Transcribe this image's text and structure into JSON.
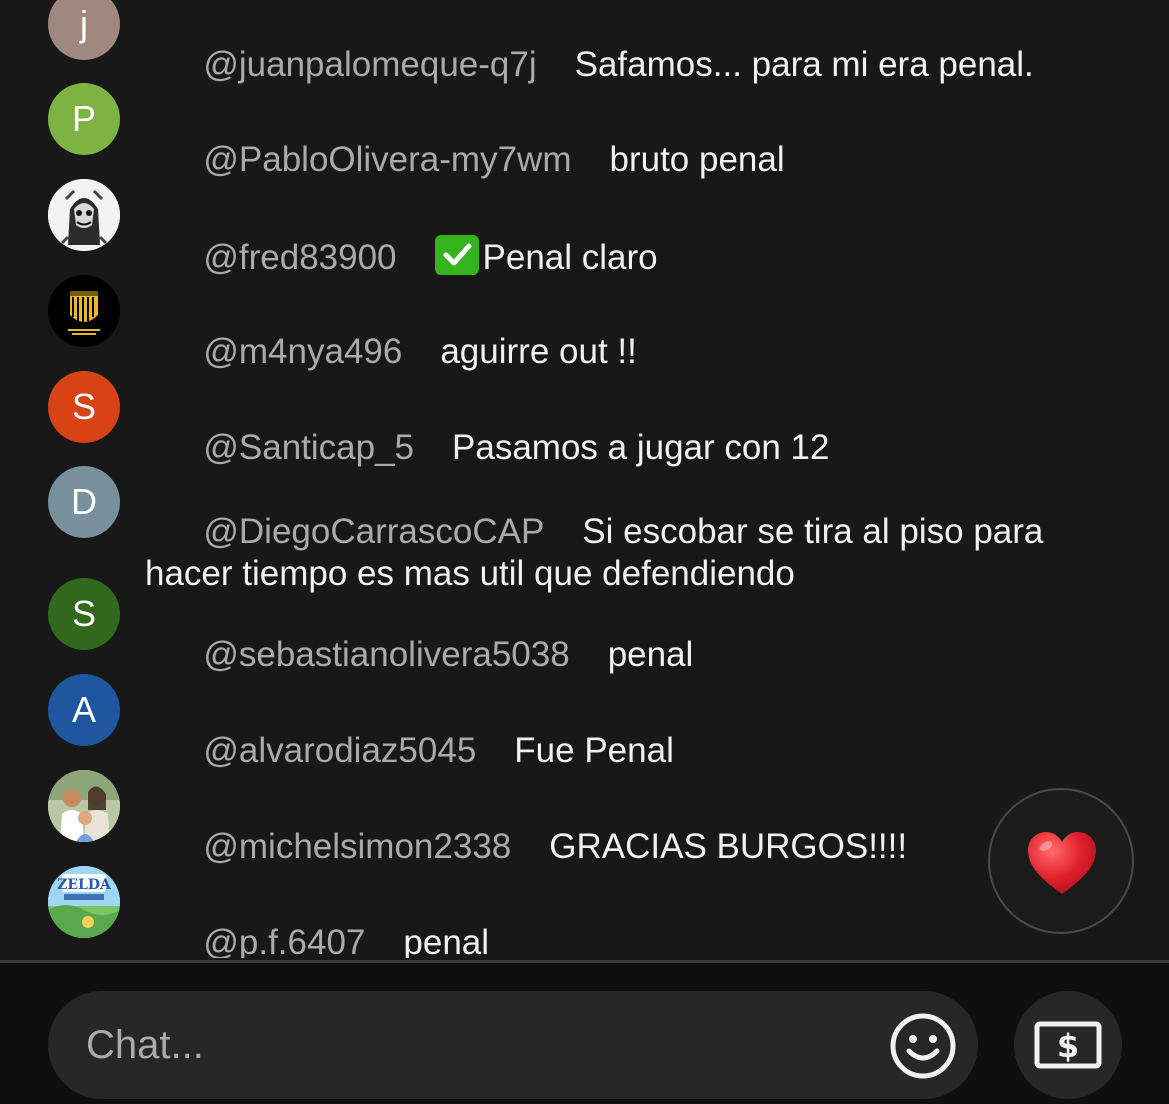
{
  "colors": {
    "background": "#181818",
    "author": "#aaaaaa",
    "message": "#f1f1f1",
    "input_bg": "#272727",
    "heart": "#e0202c"
  },
  "messages": [
    {
      "author": "@juanpalomeque-q7j",
      "text": "Safamos... para mi era penal.",
      "avatar": {
        "type": "letter",
        "letter": "j",
        "color": "#a1887f"
      }
    },
    {
      "author": "@PabloOlivera-my7wm",
      "text": "bruto penal",
      "avatar": {
        "type": "letter",
        "letter": "P",
        "color": "#7cb342"
      }
    },
    {
      "author": "@fred83900",
      "text": "Penal claro",
      "prefix_icon": "check-mark-emoji",
      "avatar": {
        "type": "image",
        "icon": "joker-photo"
      }
    },
    {
      "author": "@m4nya496",
      "text": "aguirre out !!",
      "avatar": {
        "type": "image",
        "icon": "club-crest"
      }
    },
    {
      "author": "@Santicap_5",
      "text": "Pasamos a jugar con 12",
      "avatar": {
        "type": "letter",
        "letter": "S",
        "color": "#d84315"
      }
    },
    {
      "author": "@DiegoCarrascoCAP",
      "text": "Si escobar se tira al piso para hacer tiempo es mas util que defendiendo",
      "avatar": {
        "type": "letter",
        "letter": "D",
        "color": "#78909c"
      }
    },
    {
      "author": "@sebastianolivera5038",
      "text": "penal",
      "avatar": {
        "type": "letter",
        "letter": "S",
        "color": "#33691e"
      }
    },
    {
      "author": "@alvarodiaz5045",
      "text": "Fue Penal",
      "avatar": {
        "type": "letter",
        "letter": "A",
        "color": "#1e56a0"
      }
    },
    {
      "author": "@michelsimon2338",
      "text": "GRACIAS BURGOS!!!!",
      "avatar": {
        "type": "image",
        "icon": "family-photo"
      }
    },
    {
      "author": "@p.f.6407",
      "text": "penal",
      "avatar": {
        "type": "image",
        "icon": "zelda-game-art",
        "lettering": "ZELDA"
      }
    }
  ],
  "heart_button": {
    "icon": "heart-icon"
  },
  "input": {
    "placeholder": "Chat...",
    "emoji_icon": "smiley-icon",
    "super_chat_icon": "dollar-bill-icon"
  }
}
